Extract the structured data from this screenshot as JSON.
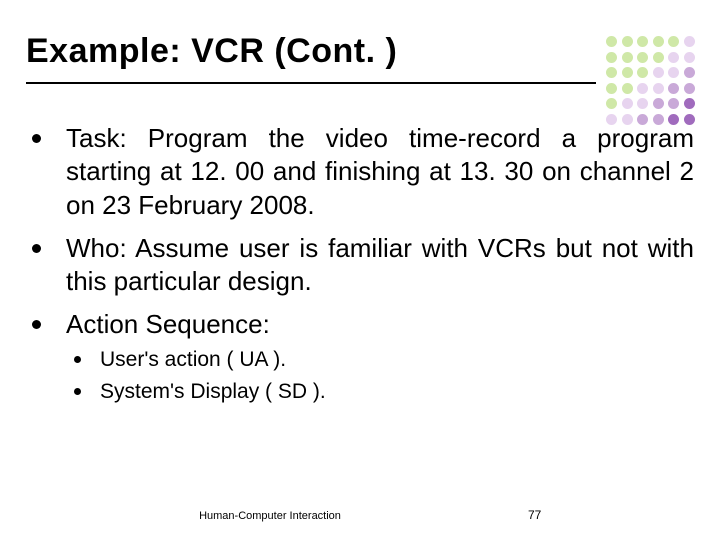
{
  "title": "Example: VCR (Cont. )",
  "bullets": {
    "b1": "Task: Program the video time-record a program starting at 12. 00 and finishing at 13. 30 on channel 2 on 23 February 2008.",
    "b2": "Who: Assume user is familiar with VCRs but not with this particular design.",
    "b3": "Action Sequence:"
  },
  "sub_bullets": {
    "s1": "User's action ( UA ).",
    "s2": "System's Display ( SD )."
  },
  "footer": {
    "text": "Human-Computer Interaction",
    "page": "77"
  },
  "decor": {
    "dot_colors": [
      "#cfe8a7",
      "#cfe8a7",
      "#cfe8a7",
      "#cfe8a7",
      "#cfe8a7",
      "#e7d4ef",
      "#cfe8a7",
      "#cfe8a7",
      "#cfe8a7",
      "#cfe8a7",
      "#e7d4ef",
      "#e7d4ef",
      "#cfe8a7",
      "#cfe8a7",
      "#cfe8a7",
      "#e7d4ef",
      "#e7d4ef",
      "#c9a9d8",
      "#cfe8a7",
      "#cfe8a7",
      "#e7d4ef",
      "#e7d4ef",
      "#c9a9d8",
      "#c9a9d8",
      "#cfe8a7",
      "#e7d4ef",
      "#e7d4ef",
      "#c9a9d8",
      "#c9a9d8",
      "#a06bbd",
      "#e7d4ef",
      "#e7d4ef",
      "#c9a9d8",
      "#c9a9d8",
      "#a06bbd",
      "#a06bbd"
    ]
  }
}
